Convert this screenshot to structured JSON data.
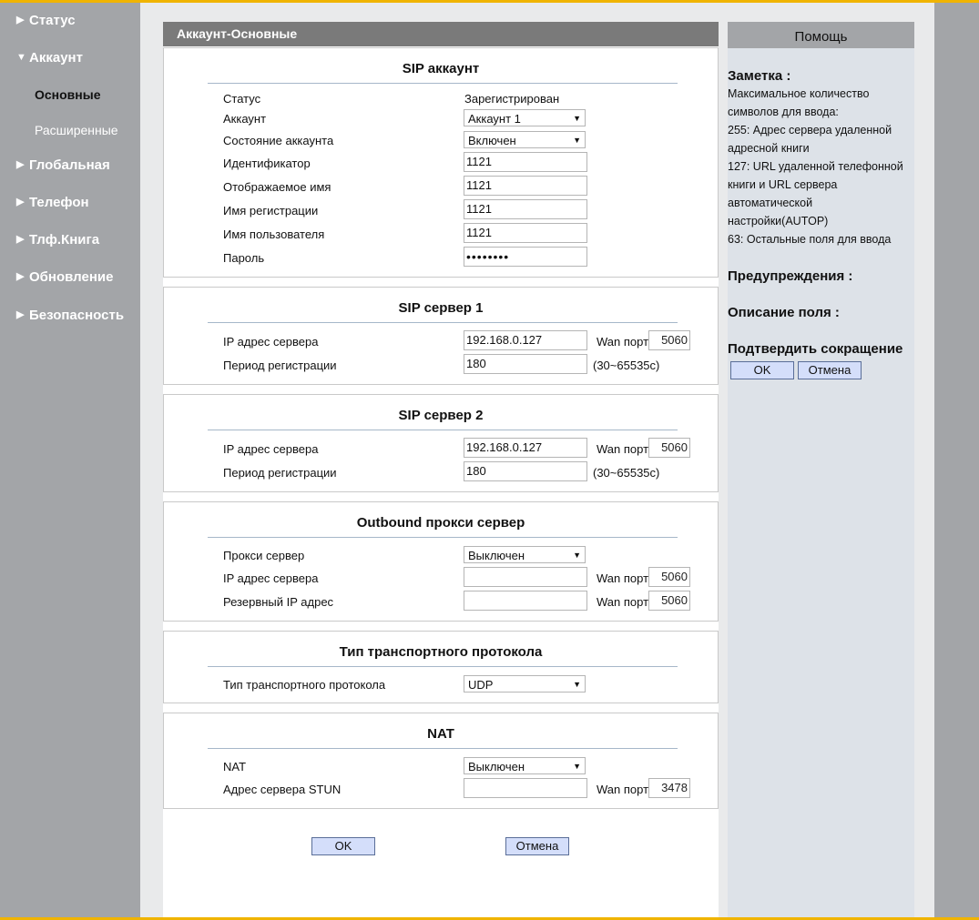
{
  "sidebar": {
    "items": [
      {
        "label": "Статус"
      },
      {
        "label": "Аккаунт"
      },
      {
        "label": "Основные"
      },
      {
        "label": "Расширенные"
      },
      {
        "label": "Глобальная"
      },
      {
        "label": "Телефон"
      },
      {
        "label": "Тлф.Книга"
      },
      {
        "label": "Обновление"
      },
      {
        "label": "Безопасность"
      }
    ],
    "icons": {
      "collapsed": "triangle-right-icon",
      "expanded": "triangle-down-icon"
    }
  },
  "page": {
    "title": "Аккаунт-Основные"
  },
  "sip_account": {
    "title": "SIP аккаунт",
    "status_label": "Статус",
    "status_value": "Зарегистрирован",
    "account_label": "Аккаунт",
    "account_value": "Аккаунт 1",
    "state_label": "Состояние аккаунта",
    "state_value": "Включен",
    "id_label": "Идентификатор",
    "id_value": "1121",
    "display_label": "Отображаемое имя",
    "display_value": "1121",
    "reg_label": "Имя регистрации",
    "reg_value": "1121",
    "user_label": "Имя пользователя",
    "user_value": "1121",
    "password_label": "Пароль",
    "password_value": "••••••••"
  },
  "sip_server1": {
    "title": "SIP сервер 1",
    "ip_label": "IP адрес сервера",
    "ip_value": "192.168.0.127",
    "wan_label": "Wan порт",
    "wan_value": "5060",
    "period_label": "Период регистрации",
    "period_value": "180",
    "range": "(30~65535c)"
  },
  "sip_server2": {
    "title": "SIP сервер 2",
    "ip_label": "IP адрес сервера",
    "ip_value": "192.168.0.127",
    "wan_label": "Wan порт",
    "wan_value": "5060",
    "period_label": "Период регистрации",
    "period_value": "180",
    "range": "(30~65535c)"
  },
  "outbound": {
    "title": "Outbound прокси сервер",
    "proxy_label": "Прокси сервер",
    "proxy_value": "Выключен",
    "ip_label": "IP адрес сервера",
    "ip_value": "",
    "wan_label": "Wan порт",
    "wan_value": "5060",
    "backup_label": "Резервный IP адрес",
    "backup_value": "",
    "backup_wan_value": "5060"
  },
  "transport": {
    "title": "Тип транспортного протокола",
    "type_label": "Тип транспортного протокола",
    "type_value": "UDP"
  },
  "nat": {
    "title": "NAT",
    "nat_label": "NAT",
    "nat_value": "Выключен",
    "stun_label": "Адрес сервера STUN",
    "stun_value": "",
    "wan_label": "Wan порт",
    "wan_value": "3478"
  },
  "actions": {
    "ok": "OK",
    "cancel": "Отмена"
  },
  "help": {
    "title": "Помощь",
    "note_heading": "Заметка :",
    "note_lines": [
      "Максимальное количество",
      "символов для ввода:",
      "255: Адрес сервера удаленной",
      "адресной книги",
      "127: URL удаленной телефонной",
      "книги и URL сервера",
      "автоматической",
      "настройки(AUTOP)",
      "63: Остальные поля для ввода"
    ],
    "warnings_heading": "Предупреждения :",
    "field_desc_heading": "Описание поля :",
    "confirm_heading": "Подтвердить сокращение",
    "ok": "OK",
    "cancel": "Отмена"
  },
  "colors": {
    "accent_bar": "#f0b400",
    "sidebar": "#a3a5a8",
    "title_bar": "#7a7a7a",
    "button": "#d4defa",
    "help_bg": "#dde2e8"
  }
}
